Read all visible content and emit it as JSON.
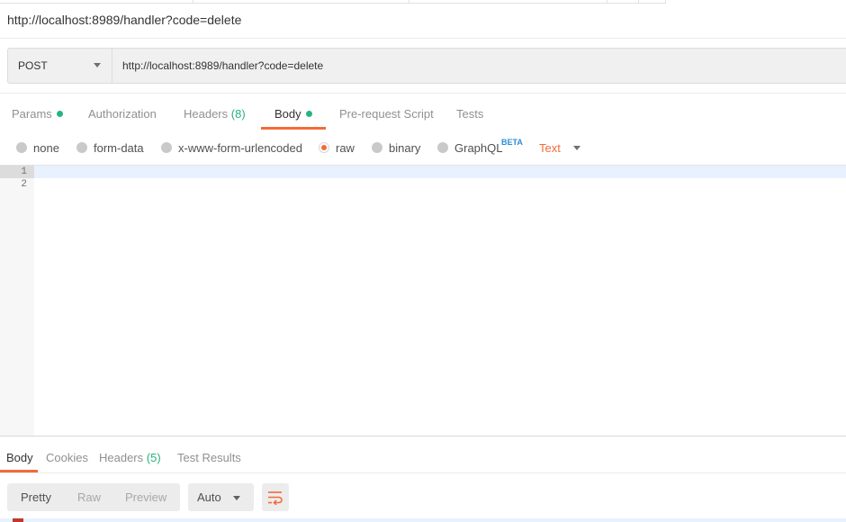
{
  "request": {
    "title": "http://localhost:8989/handler?code=delete",
    "method": "POST",
    "url": "http://localhost:8989/handler?code=delete"
  },
  "request_tabs": {
    "params": "Params",
    "authorization": "Authorization",
    "headers": "Headers",
    "headers_count": "(8)",
    "body": "Body",
    "pre_request": "Pre-request Script",
    "tests": "Tests"
  },
  "body_options": {
    "none": "none",
    "form_data": "form-data",
    "urlencoded": "x-www-form-urlencoded",
    "raw": "raw",
    "binary": "binary",
    "graphql": "GraphQL",
    "beta": "BETA",
    "selected": "raw",
    "format": "Text"
  },
  "editor": {
    "line_numbers": [
      "1",
      "2"
    ]
  },
  "response_tabs": {
    "body": "Body",
    "cookies": "Cookies",
    "headers": "Headers",
    "headers_count": "(5)",
    "test_results": "Test Results"
  },
  "response_toolbar": {
    "pretty": "Pretty",
    "raw": "Raw",
    "preview": "Preview",
    "auto": "Auto"
  },
  "colors": {
    "accent": "#f26b3a",
    "green": "#26b47f",
    "beta": "#2a8ed8"
  },
  "icons": {
    "wrap": "wrap-lines-icon",
    "method_caret": "chevron-down-icon"
  }
}
